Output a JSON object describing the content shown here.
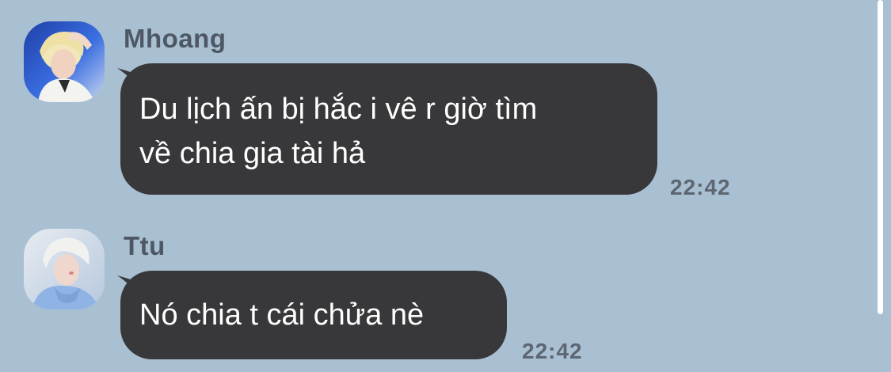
{
  "theme": {
    "background": "#a9bfd2",
    "bubble_color": "#38383a",
    "bubble_text_color": "#ffffff",
    "name_color": "#4d5864",
    "time_color": "#5d6772",
    "scrollbar_color": "#ffffff"
  },
  "messages": [
    {
      "sender": "Mhoang",
      "avatar_icon": "profile-photo",
      "text": "Du lịch ấn bị hắc i vê r giờ tìm\nvề chia gia tài hả",
      "time": "22:42"
    },
    {
      "sender": "Ttu",
      "avatar_icon": "profile-photo",
      "text": "Nó chia t cái chửa nè",
      "time": "22:42"
    }
  ]
}
